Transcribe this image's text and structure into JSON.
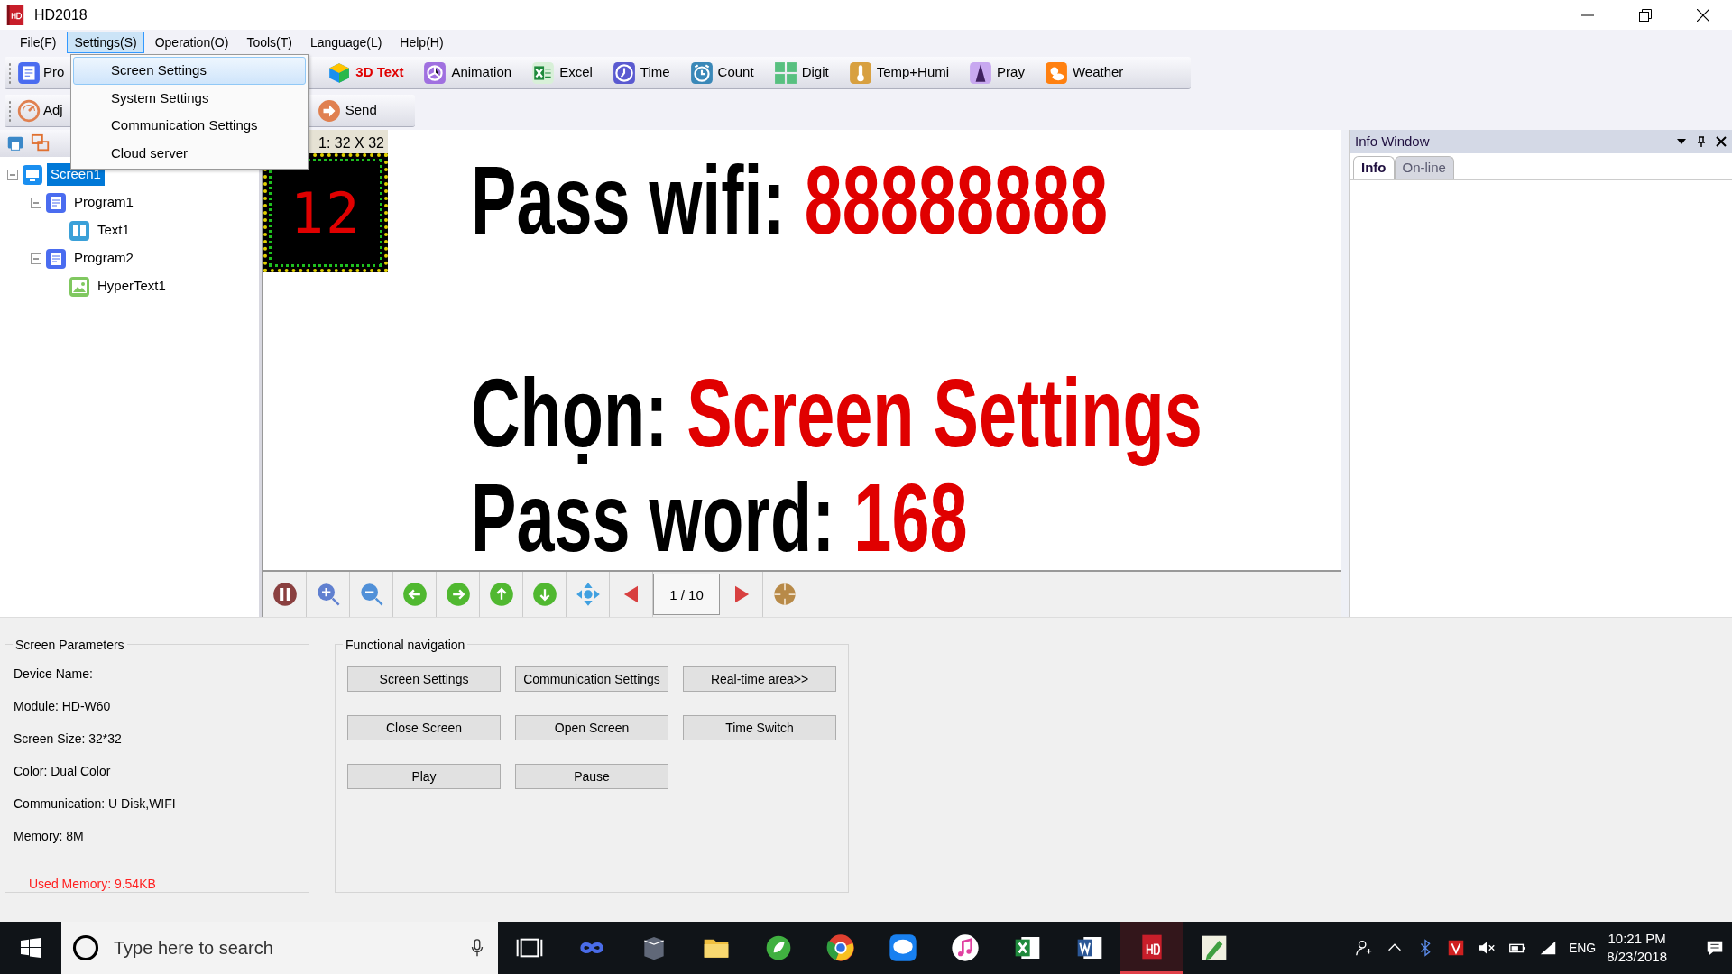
{
  "window": {
    "title": "HD2018"
  },
  "menu": [
    {
      "label": "File(F)",
      "selected": false
    },
    {
      "label": "Settings(S)",
      "selected": true
    },
    {
      "label": "Operation(O)",
      "selected": false
    },
    {
      "label": "Tools(T)",
      "selected": false
    },
    {
      "label": "Language(L)",
      "selected": false
    },
    {
      "label": "Help(H)",
      "selected": false
    }
  ],
  "dropdown": [
    {
      "label": "Screen Settings",
      "selected": true
    },
    {
      "label": "System Settings",
      "selected": false
    },
    {
      "label": "Communication Settings",
      "selected": false
    },
    {
      "label": "Cloud server",
      "selected": false
    }
  ],
  "toolbar_1": [
    {
      "label": "Pro",
      "kind": "program",
      "highlighted": false
    },
    {
      "label": "3D Text",
      "kind": "cube",
      "highlighted": true
    },
    {
      "label": "Animation",
      "kind": "animation",
      "highlighted": false
    },
    {
      "label": "Excel",
      "kind": "excel",
      "highlighted": false
    },
    {
      "label": "Time",
      "kind": "clock",
      "highlighted": false
    },
    {
      "label": "Count",
      "kind": "count",
      "highlighted": false
    },
    {
      "label": "Digit",
      "kind": "digit",
      "highlighted": false
    },
    {
      "label": "Temp+Humi",
      "kind": "temp",
      "highlighted": false
    },
    {
      "label": "Pray",
      "kind": "pray",
      "highlighted": false
    },
    {
      "label": "Weather",
      "kind": "weather",
      "highlighted": false
    }
  ],
  "toolbar_2": [
    {
      "label": "Adj",
      "kind": "adjust"
    },
    {
      "label": "Send",
      "kind": "send"
    }
  ],
  "tree": [
    {
      "label": "Screen1",
      "kind": "screen",
      "selected": true,
      "expanded": true,
      "children": [
        {
          "label": "Program1",
          "kind": "program",
          "selected": false,
          "expanded": true,
          "children": [
            {
              "label": "Text1",
              "kind": "text",
              "selected": false
            }
          ]
        },
        {
          "label": "Program2",
          "kind": "program",
          "selected": false,
          "expanded": true,
          "children": [
            {
              "label": "HyperText1",
              "kind": "image",
              "selected": false
            }
          ]
        }
      ]
    }
  ],
  "preview": {
    "size_label": "1: 32 X 32",
    "led_text": "12",
    "lines": [
      {
        "label": "Pass wifi: ",
        "value": "88888888"
      },
      {
        "label": "Chọn: ",
        "value": "Screen Settings"
      },
      {
        "label": "Pass word: ",
        "value": "168"
      }
    ]
  },
  "playback": {
    "page": "1 / 10"
  },
  "info_window": {
    "title": "Info Window",
    "tabs": [
      {
        "label": "Info",
        "selected": true
      },
      {
        "label": "On-line",
        "selected": false
      }
    ]
  },
  "screen_parameters": {
    "title": "Screen Parameters",
    "lines": [
      {
        "text": "Device Name:",
        "alert": false
      },
      {
        "text": "Module: HD-W60",
        "alert": false
      },
      {
        "text": "Screen Size: 32*32",
        "alert": false
      },
      {
        "text": "Color: Dual Color",
        "alert": false
      },
      {
        "text": "Communication: U Disk,WIFI",
        "alert": false
      },
      {
        "text": "Memory: 8M",
        "alert": false
      },
      {
        "text": "Used Memory: 9.54KB",
        "alert": true
      }
    ]
  },
  "functional_navigation": {
    "title": "Functional navigation",
    "buttons": [
      "Screen Settings",
      "Communication Settings",
      "Real-time area>>",
      "Close Screen",
      "Open Screen",
      "Time Switch",
      "Play",
      "Pause"
    ]
  },
  "taskbar": {
    "search_placeholder": "Type here to search",
    "language": "ENG",
    "time": "10:21 PM",
    "date": "8/23/2018",
    "apps": [
      {
        "kind": "infinity",
        "active": false
      },
      {
        "kind": "book",
        "active": false
      },
      {
        "kind": "folder",
        "active": false
      },
      {
        "kind": "leaf",
        "active": false
      },
      {
        "kind": "browser",
        "active": false
      },
      {
        "kind": "chat",
        "active": false
      },
      {
        "kind": "music",
        "active": false
      },
      {
        "kind": "excel",
        "active": false
      },
      {
        "kind": "word",
        "active": false
      },
      {
        "kind": "hd",
        "active": true
      },
      {
        "kind": "pen",
        "active": false
      }
    ]
  }
}
